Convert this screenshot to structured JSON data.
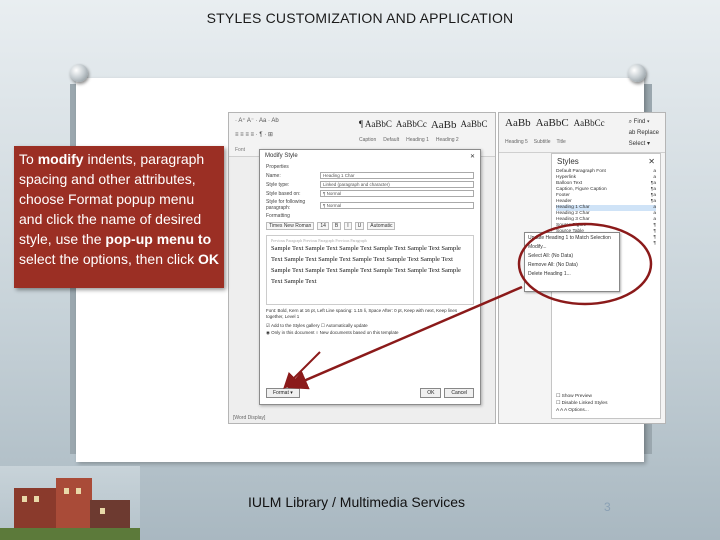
{
  "slide": {
    "title": "STYLES CUSTOMIZATION AND APPLICATION",
    "footer": "IULM Library / Multimedia Services",
    "page_number": "3"
  },
  "callout": {
    "t1": "To ",
    "t2": "modify",
    "t3": " indents, paragraph spacing and other attributes, choose Format popup menu and click the name of desired style, use the ",
    "t4": "pop-up menu to",
    "t5": " select the options, then click ",
    "t6": "OK"
  },
  "word": {
    "ribbon_row1": "· A⁺ A⁻ · Aa · Ab",
    "ribbon_row2": "≡ ≡ ≡ ≡ · ¶ · ⊞",
    "gallery": [
      "¶ AaBbC",
      "AaBbCc",
      "AaBb",
      "AaBbC"
    ],
    "gallery_labels": [
      "Caption",
      "Default",
      "Heading 1",
      "Heading 2"
    ],
    "clipboard": "Font",
    "dialog": {
      "title": "Modify Style",
      "close": "✕",
      "section_properties": "Properties",
      "rows": [
        {
          "label": "Name:",
          "value": "Heading 1 Char"
        },
        {
          "label": "Style type:",
          "value": "Linked (paragraph and character)"
        },
        {
          "label": "Style based on:",
          "value": "¶ Normal"
        },
        {
          "label": "Style for following paragraph:",
          "value": "¶ Normal"
        }
      ],
      "section_formatting": "Formatting",
      "fmt": [
        "Times New Roman",
        "14",
        "B",
        "I",
        "U",
        "Automatic"
      ],
      "preview_prev": "Previous Paragraph Previous Paragraph Previous Paragraph",
      "preview_sample": "Sample Text Sample Text Sample Text Sample Text Sample Text Sample Text Sample Text Sample Text Sample Text Sample Text Sample Text Sample Text Sample Text Sample Text Sample Text Sample Text Sample Text Sample Text",
      "description": "Font: Bold, Kern at 16 pt, Left Line spacing: 1.15 li, Space After: 0 pt, Keep with next, Keep lines together, Level 1",
      "check1": "☑ Add to the Styles gallery   ☐ Automatically update",
      "check2": "◉ Only in this document   ○ New documents based on this template",
      "format_button": "Format ▾",
      "ok_button": "OK",
      "cancel_button": "Cancel"
    },
    "status": "[Word Display]"
  },
  "styles_pane": {
    "gallery": [
      "AaBb",
      "AaBbC",
      "AaBbCc"
    ],
    "labels": [
      "Heading 5",
      "Subtitle",
      "Title"
    ],
    "find": "⌕ Find ▾",
    "replace": "ab Replace",
    "select": "Select ▾",
    "title": "Styles",
    "close": "✕",
    "items": [
      "Default Paragraph Font",
      "Hyperlink",
      "Balloon Text",
      "Caption, Figure Caption",
      "Footer",
      "Header",
      "Heading 1 Char",
      "Heading 2 Char",
      "Heading 3 Char",
      "Source Figure",
      "Source Table",
      "Table",
      "Table Caption"
    ],
    "item_marks": [
      "a",
      "a",
      "¶a",
      "¶a",
      "¶a",
      "¶a",
      "a",
      "a",
      "a",
      "¶",
      "¶",
      "¶",
      "¶"
    ],
    "foot1": "☐ Show Preview",
    "foot2": "☐ Disable Linked Styles",
    "foot3": "A  A  A       Options..."
  },
  "popup": {
    "items": [
      "Update Heading 1 to Match Selection",
      "Modify...",
      "Select All: (No Data)",
      "Remove All: (No Data)",
      "Delete Heading 1..."
    ]
  },
  "colors": {
    "callout_bg": "#9b2f24",
    "arrow": "#8b1a1a"
  }
}
